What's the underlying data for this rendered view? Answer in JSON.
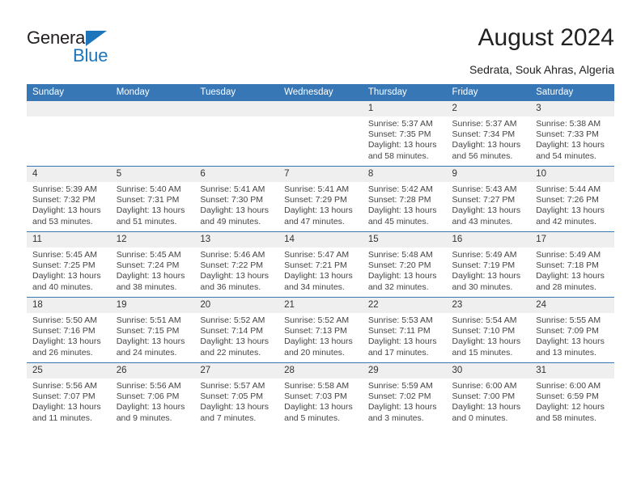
{
  "brand": {
    "name_top": "General",
    "name_bottom": "Blue",
    "triangle_color": "#1c74bb"
  },
  "header": {
    "title": "August 2024",
    "subtitle": "Sedrata, Souk Ahras, Algeria"
  },
  "theme": {
    "header_row_bg": "#3877b5",
    "daynum_bg": "#efefef",
    "separator": "#3877b5",
    "text": "#444444"
  },
  "columns": [
    "Sunday",
    "Monday",
    "Tuesday",
    "Wednesday",
    "Thursday",
    "Friday",
    "Saturday"
  ],
  "weeks": [
    [
      {
        "day": "",
        "empty": true
      },
      {
        "day": "",
        "empty": true
      },
      {
        "day": "",
        "empty": true
      },
      {
        "day": "",
        "empty": true
      },
      {
        "day": "1",
        "sunrise": "Sunrise: 5:37 AM",
        "sunset": "Sunset: 7:35 PM",
        "daylight": "Daylight: 13 hours and 58 minutes."
      },
      {
        "day": "2",
        "sunrise": "Sunrise: 5:37 AM",
        "sunset": "Sunset: 7:34 PM",
        "daylight": "Daylight: 13 hours and 56 minutes."
      },
      {
        "day": "3",
        "sunrise": "Sunrise: 5:38 AM",
        "sunset": "Sunset: 7:33 PM",
        "daylight": "Daylight: 13 hours and 54 minutes."
      }
    ],
    [
      {
        "day": "4",
        "sunrise": "Sunrise: 5:39 AM",
        "sunset": "Sunset: 7:32 PM",
        "daylight": "Daylight: 13 hours and 53 minutes."
      },
      {
        "day": "5",
        "sunrise": "Sunrise: 5:40 AM",
        "sunset": "Sunset: 7:31 PM",
        "daylight": "Daylight: 13 hours and 51 minutes."
      },
      {
        "day": "6",
        "sunrise": "Sunrise: 5:41 AM",
        "sunset": "Sunset: 7:30 PM",
        "daylight": "Daylight: 13 hours and 49 minutes."
      },
      {
        "day": "7",
        "sunrise": "Sunrise: 5:41 AM",
        "sunset": "Sunset: 7:29 PM",
        "daylight": "Daylight: 13 hours and 47 minutes."
      },
      {
        "day": "8",
        "sunrise": "Sunrise: 5:42 AM",
        "sunset": "Sunset: 7:28 PM",
        "daylight": "Daylight: 13 hours and 45 minutes."
      },
      {
        "day": "9",
        "sunrise": "Sunrise: 5:43 AM",
        "sunset": "Sunset: 7:27 PM",
        "daylight": "Daylight: 13 hours and 43 minutes."
      },
      {
        "day": "10",
        "sunrise": "Sunrise: 5:44 AM",
        "sunset": "Sunset: 7:26 PM",
        "daylight": "Daylight: 13 hours and 42 minutes."
      }
    ],
    [
      {
        "day": "11",
        "sunrise": "Sunrise: 5:45 AM",
        "sunset": "Sunset: 7:25 PM",
        "daylight": "Daylight: 13 hours and 40 minutes."
      },
      {
        "day": "12",
        "sunrise": "Sunrise: 5:45 AM",
        "sunset": "Sunset: 7:24 PM",
        "daylight": "Daylight: 13 hours and 38 minutes."
      },
      {
        "day": "13",
        "sunrise": "Sunrise: 5:46 AM",
        "sunset": "Sunset: 7:22 PM",
        "daylight": "Daylight: 13 hours and 36 minutes."
      },
      {
        "day": "14",
        "sunrise": "Sunrise: 5:47 AM",
        "sunset": "Sunset: 7:21 PM",
        "daylight": "Daylight: 13 hours and 34 minutes."
      },
      {
        "day": "15",
        "sunrise": "Sunrise: 5:48 AM",
        "sunset": "Sunset: 7:20 PM",
        "daylight": "Daylight: 13 hours and 32 minutes."
      },
      {
        "day": "16",
        "sunrise": "Sunrise: 5:49 AM",
        "sunset": "Sunset: 7:19 PM",
        "daylight": "Daylight: 13 hours and 30 minutes."
      },
      {
        "day": "17",
        "sunrise": "Sunrise: 5:49 AM",
        "sunset": "Sunset: 7:18 PM",
        "daylight": "Daylight: 13 hours and 28 minutes."
      }
    ],
    [
      {
        "day": "18",
        "sunrise": "Sunrise: 5:50 AM",
        "sunset": "Sunset: 7:16 PM",
        "daylight": "Daylight: 13 hours and 26 minutes."
      },
      {
        "day": "19",
        "sunrise": "Sunrise: 5:51 AM",
        "sunset": "Sunset: 7:15 PM",
        "daylight": "Daylight: 13 hours and 24 minutes."
      },
      {
        "day": "20",
        "sunrise": "Sunrise: 5:52 AM",
        "sunset": "Sunset: 7:14 PM",
        "daylight": "Daylight: 13 hours and 22 minutes."
      },
      {
        "day": "21",
        "sunrise": "Sunrise: 5:52 AM",
        "sunset": "Sunset: 7:13 PM",
        "daylight": "Daylight: 13 hours and 20 minutes."
      },
      {
        "day": "22",
        "sunrise": "Sunrise: 5:53 AM",
        "sunset": "Sunset: 7:11 PM",
        "daylight": "Daylight: 13 hours and 17 minutes."
      },
      {
        "day": "23",
        "sunrise": "Sunrise: 5:54 AM",
        "sunset": "Sunset: 7:10 PM",
        "daylight": "Daylight: 13 hours and 15 minutes."
      },
      {
        "day": "24",
        "sunrise": "Sunrise: 5:55 AM",
        "sunset": "Sunset: 7:09 PM",
        "daylight": "Daylight: 13 hours and 13 minutes."
      }
    ],
    [
      {
        "day": "25",
        "sunrise": "Sunrise: 5:56 AM",
        "sunset": "Sunset: 7:07 PM",
        "daylight": "Daylight: 13 hours and 11 minutes."
      },
      {
        "day": "26",
        "sunrise": "Sunrise: 5:56 AM",
        "sunset": "Sunset: 7:06 PM",
        "daylight": "Daylight: 13 hours and 9 minutes."
      },
      {
        "day": "27",
        "sunrise": "Sunrise: 5:57 AM",
        "sunset": "Sunset: 7:05 PM",
        "daylight": "Daylight: 13 hours and 7 minutes."
      },
      {
        "day": "28",
        "sunrise": "Sunrise: 5:58 AM",
        "sunset": "Sunset: 7:03 PM",
        "daylight": "Daylight: 13 hours and 5 minutes."
      },
      {
        "day": "29",
        "sunrise": "Sunrise: 5:59 AM",
        "sunset": "Sunset: 7:02 PM",
        "daylight": "Daylight: 13 hours and 3 minutes."
      },
      {
        "day": "30",
        "sunrise": "Sunrise: 6:00 AM",
        "sunset": "Sunset: 7:00 PM",
        "daylight": "Daylight: 13 hours and 0 minutes."
      },
      {
        "day": "31",
        "sunrise": "Sunrise: 6:00 AM",
        "sunset": "Sunset: 6:59 PM",
        "daylight": "Daylight: 12 hours and 58 minutes."
      }
    ]
  ]
}
